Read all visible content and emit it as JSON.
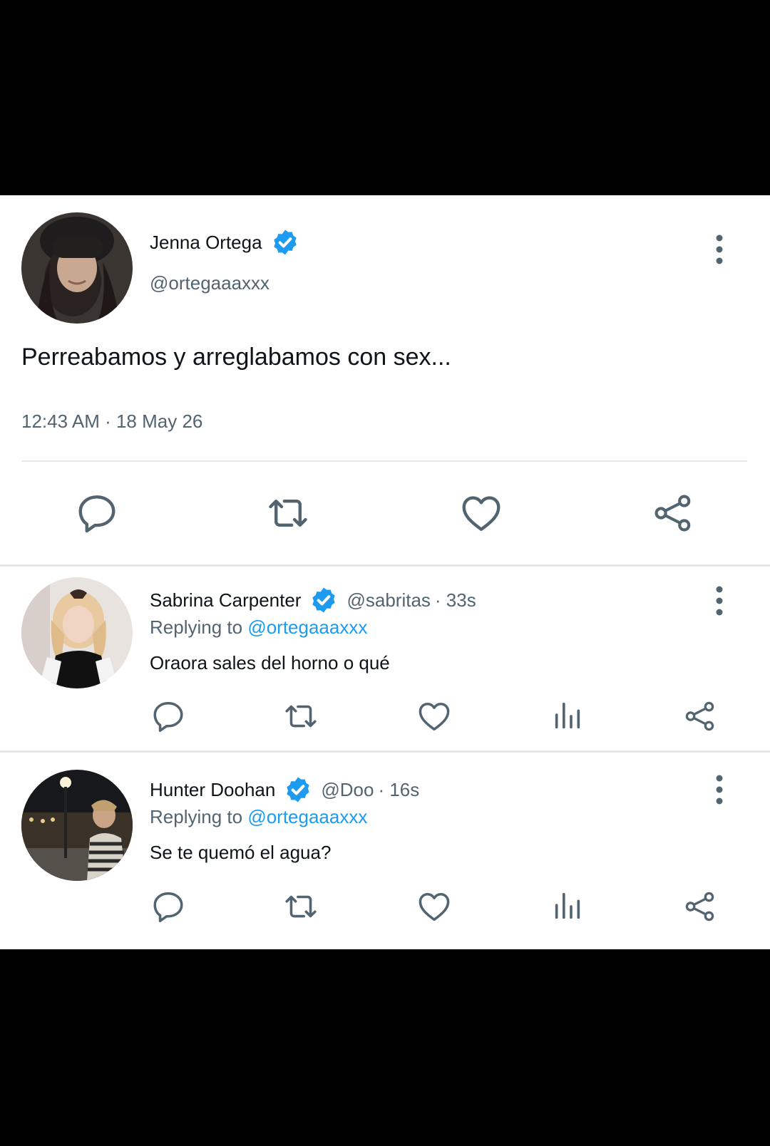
{
  "main_tweet": {
    "display_name": "Jenna Ortega",
    "handle": "@ortegaaaxxx",
    "text": "Perreabamos y arreglabamos con sex...",
    "timestamp": "12:43 AM · 18 May 26",
    "actions": [
      "reply-icon",
      "retweet-icon",
      "like-icon",
      "share-icon"
    ]
  },
  "replies": [
    {
      "display_name": "Sabrina Carpenter",
      "handle": "@sabritas",
      "time": "· 33s",
      "replying_prefix": "Replying to ",
      "replying_handle": "@ortegaaaxxx",
      "text": "Oraora sales del horno o qué",
      "actions": [
        "reply-icon",
        "retweet-icon",
        "like-icon",
        "views-icon",
        "share-icon"
      ]
    },
    {
      "display_name": "Hunter Doohan",
      "handle": "@Doo",
      "time": "· 16s",
      "replying_prefix": "Replying to ",
      "replying_handle": "@ortegaaaxxx",
      "text": "Se te quemó el agua?",
      "actions": [
        "reply-icon",
        "retweet-icon",
        "like-icon",
        "views-icon",
        "share-icon"
      ]
    }
  ],
  "colors": {
    "verified": "#1d9bf0",
    "mention": "#1d9bf0",
    "secondary_text": "#536471",
    "icon": "#536471",
    "background_outer": "#000000",
    "card": "#ffffff"
  }
}
